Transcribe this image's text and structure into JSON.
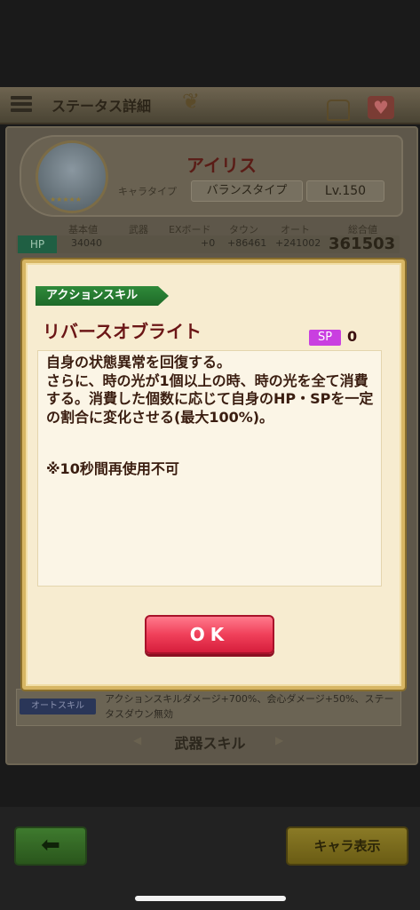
{
  "header": {
    "title": "ステータス詳細"
  },
  "character": {
    "name": "アイリス",
    "type_label": "キャラタイプ",
    "type_value": "バランスタイプ",
    "level": "Lv.150",
    "stars": "★★★★★"
  },
  "stats": {
    "headers": [
      "基本値",
      "武器",
      "EXボード",
      "タウン",
      "オート",
      "総合値"
    ],
    "hp_label": "HP",
    "base": "34040",
    "weapon": "",
    "ex_board": "+0",
    "town": "+86461",
    "auto": "+241002",
    "total": "361503"
  },
  "auto_skill": {
    "tag": "オートスキル",
    "description": "アクションスキルダメージ+700%、会心ダメージ+50%、ステータスダウン無効"
  },
  "weapon_skill": {
    "title": "武器スキル"
  },
  "modal": {
    "category": "アクションスキル",
    "skill_name": "リバースオブライト",
    "sp_label": "SP",
    "sp_value": "0",
    "description_lines": [
      "自身の状態異常を回復する。",
      "さらに、時の光が1個以上の時、時の光を全て消費する。消費した個数に応じて自身のHP・SPを一定の割合に変化させる(最大100%)。"
    ],
    "note": "※10秒間再使用不可",
    "ok_label": "OK"
  },
  "footer": {
    "back_icon": "arrow-left-icon",
    "chara_button": "キャラ表示"
  },
  "colors": {
    "modal_bg": "#f7ecd0",
    "modal_border": "#d7b664",
    "ok_button": "#f0405a",
    "category_tag": "#2f8a3a",
    "skill_name": "#6b1616",
    "sp_badge": "#c93fe0"
  }
}
